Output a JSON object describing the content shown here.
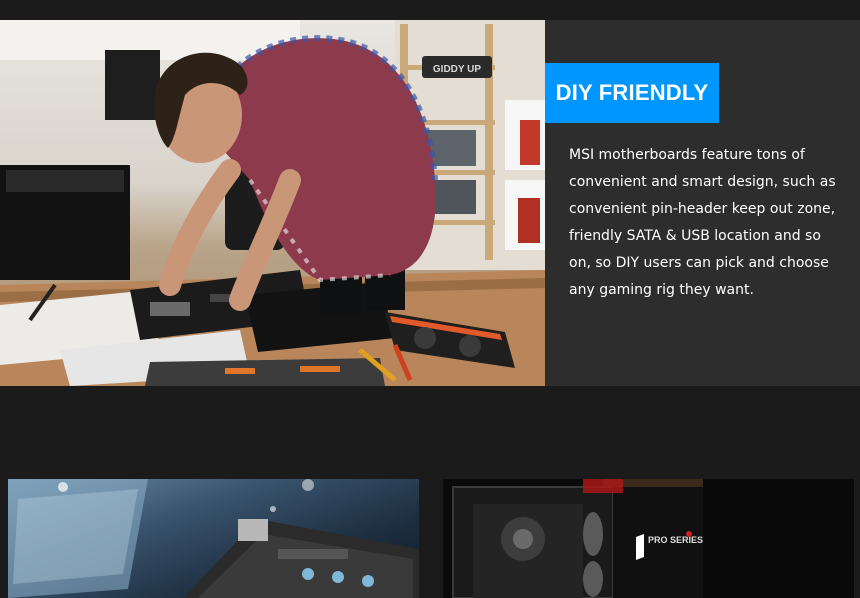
{
  "hero": {
    "badge_label": "DIY FRIENDLY",
    "description": "MSI motherboards feature tons of convenient and smart design, such as convenient pin-header keep out zone, friendly SATA & USB location and so on, so DIY users can pick and choose any gaming rig they want.",
    "shelf_sign_text": "GIDDY UP",
    "accent_color": "#0096ff"
  },
  "cards": {
    "right_case_logo_text": "PRO SERIES"
  }
}
